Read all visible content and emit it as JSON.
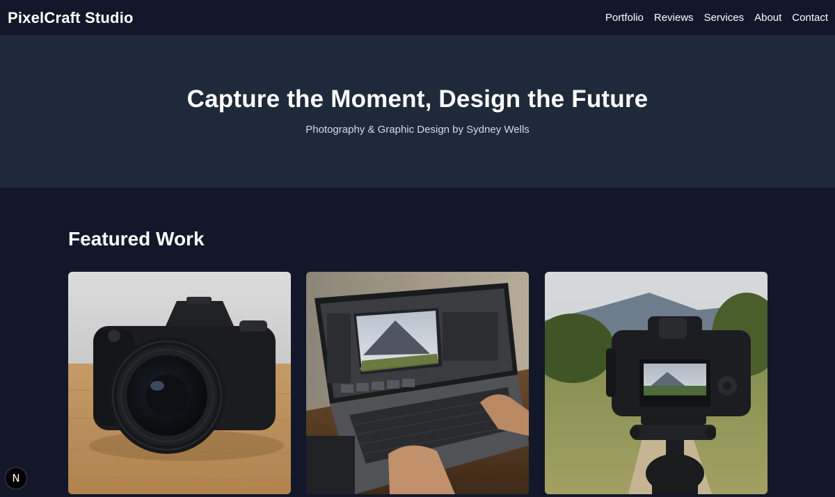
{
  "header": {
    "brand": "PixelCraft Studio",
    "nav": [
      "Portfolio",
      "Reviews",
      "Services",
      "About",
      "Contact"
    ]
  },
  "hero": {
    "title": "Capture the Moment, Design the Future",
    "subtitle": "Photography & Graphic Design by Sydney Wells"
  },
  "featured": {
    "title": "Featured Work",
    "items": [
      {
        "image": "dslr-camera-on-wooden-table"
      },
      {
        "image": "laptop-photo-editing-mountain"
      },
      {
        "image": "camera-on-tripod-mountain-landscape"
      }
    ]
  },
  "dev_badge": {
    "label": "N"
  },
  "colors": {
    "background": "#121829",
    "hero_background": "#1e2939",
    "text": "#ffffff"
  }
}
